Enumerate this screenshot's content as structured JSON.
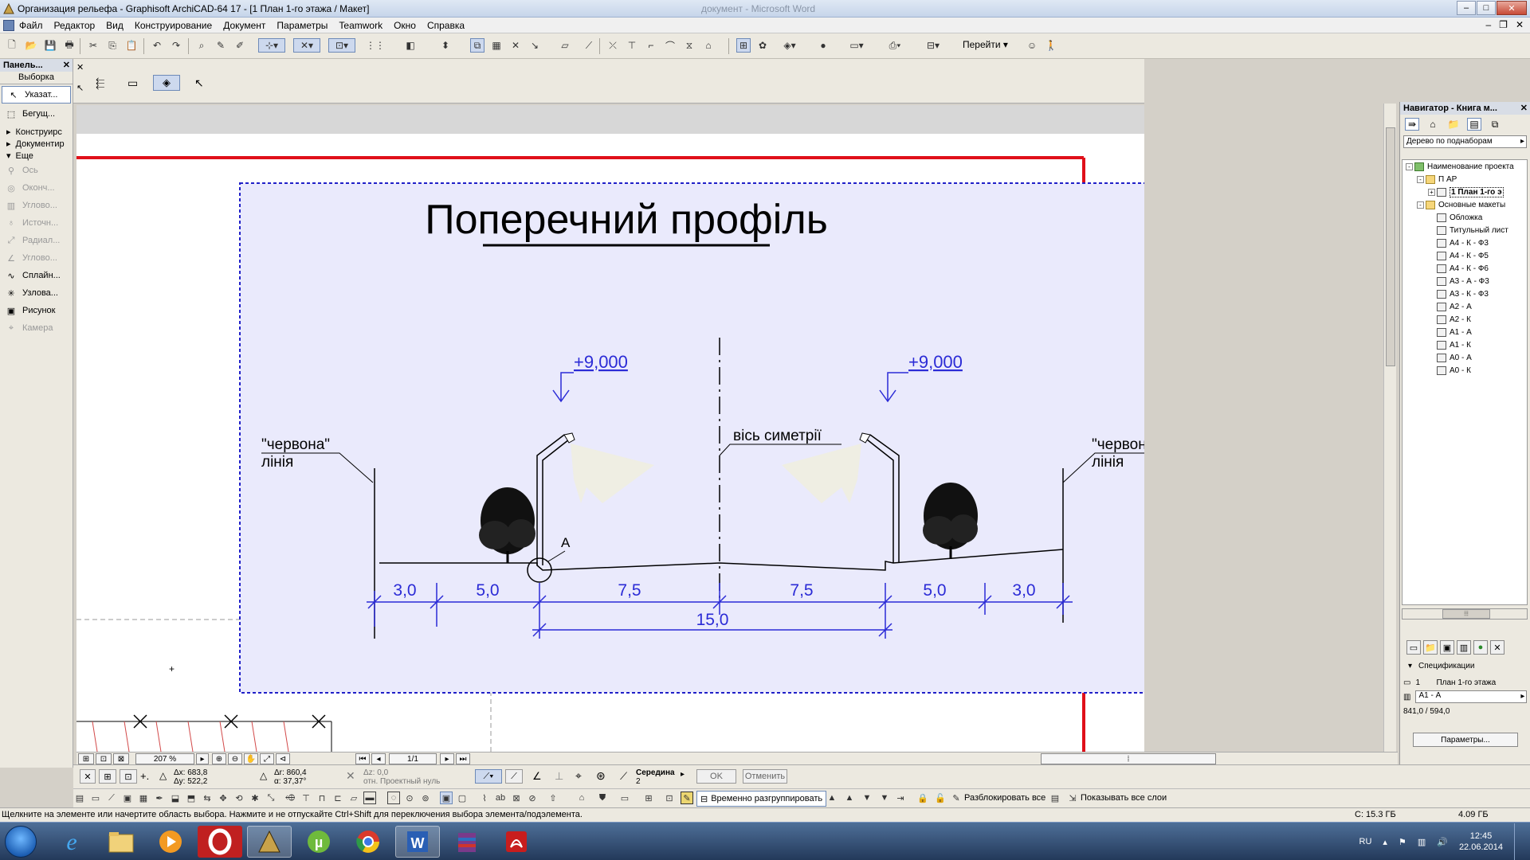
{
  "window": {
    "title": "Организация рельефа - Graphisoft ArchiCAD-64 17 - [1 План 1-го этажа / Макет]",
    "ghost_title": "документ - Microsoft Word"
  },
  "menu": {
    "items": [
      "Файл",
      "Редактор",
      "Вид",
      "Конструирование",
      "Документ",
      "Параметры",
      "Teamwork",
      "Окно",
      "Справка"
    ]
  },
  "toolbar": {
    "goto_label": "Перейти"
  },
  "toolbox": {
    "title": "Панель...",
    "tab": "Выборка",
    "selected_tools": [
      {
        "label": "Указат...",
        "icon": "arrow-pointer-icon"
      },
      {
        "label": "Бегущ...",
        "icon": "marquee-icon"
      }
    ],
    "sections": [
      {
        "label": "Конструирс",
        "expanded": false
      },
      {
        "label": "Документир",
        "expanded": false
      },
      {
        "label": "Еще",
        "expanded": true
      }
    ],
    "more_tools": [
      {
        "label": "Ось",
        "enabled": false,
        "icon": "axis-icon"
      },
      {
        "label": "Оконч...",
        "enabled": false,
        "icon": "finish-icon"
      },
      {
        "label": "Углово...",
        "enabled": false,
        "icon": "corner-window-icon"
      },
      {
        "label": "Источн...",
        "enabled": false,
        "icon": "lamp-icon"
      },
      {
        "label": "Радиал...",
        "enabled": false,
        "icon": "radial-dimension-icon"
      },
      {
        "label": "Углово...",
        "enabled": false,
        "icon": "angle-dimension-icon"
      },
      {
        "label": "Сплайн...",
        "enabled": true,
        "icon": "spline-icon"
      },
      {
        "label": "Узлова...",
        "enabled": true,
        "icon": "hotspot-icon"
      },
      {
        "label": "Рисунок",
        "enabled": true,
        "icon": "picture-icon"
      },
      {
        "label": "Камера",
        "enabled": false,
        "icon": "camera-icon"
      }
    ]
  },
  "drawing": {
    "title": "Поперечний профіль",
    "left_level": "+9,000",
    "right_level": "+9,000",
    "axis_label": "вісь симетрії",
    "red_line_left": [
      "\"червона\"",
      "лінія"
    ],
    "red_line_right": [
      "\"червона\"",
      "лінія"
    ],
    "point_label": "А",
    "dimensions": [
      "3,0",
      "5,0",
      "7,5",
      "7,5",
      "5,0",
      "3,0"
    ],
    "total_dimension": "15,0",
    "colors": {
      "annotation": "#2b2bd6",
      "background": "#eaeafc",
      "sheet_border": "#e0101a",
      "frame": "#2020c8"
    }
  },
  "view_controls": {
    "zoom": "207 %",
    "page": "1/1"
  },
  "navigator": {
    "title": "Навигатор - Книга м...",
    "dropdown": "Дерево по поднаборам",
    "tree": [
      {
        "label": "Наименование проекта",
        "level": 0,
        "expander": "-",
        "icon": "green"
      },
      {
        "label": "П АР",
        "level": 1,
        "expander": "-",
        "icon": "folder"
      },
      {
        "label": "1 План 1-го э",
        "level": 2,
        "expander": "+",
        "icon": "sheet",
        "selected": true
      },
      {
        "label": "Основные макеты",
        "level": 1,
        "expander": "-",
        "icon": "folder"
      },
      {
        "label": "Обложка",
        "level": 2,
        "expander": "",
        "icon": "sheet"
      },
      {
        "label": "Титульный лист",
        "level": 2,
        "expander": "",
        "icon": "sheet"
      },
      {
        "label": "А4 - К - Ф3",
        "level": 2,
        "expander": "",
        "icon": "sheet"
      },
      {
        "label": "А4 - К - Ф5",
        "level": 2,
        "expander": "",
        "icon": "sheet"
      },
      {
        "label": "А4 - К - Ф6",
        "level": 2,
        "expander": "",
        "icon": "sheet"
      },
      {
        "label": "А3 - А - Ф3",
        "level": 2,
        "expander": "",
        "icon": "sheet"
      },
      {
        "label": "А3 - К - Ф3",
        "level": 2,
        "expander": "",
        "icon": "sheet"
      },
      {
        "label": "А2 - А",
        "level": 2,
        "expander": "",
        "icon": "sheet"
      },
      {
        "label": "А2 - К",
        "level": 2,
        "expander": "",
        "icon": "sheet"
      },
      {
        "label": "А1 - А",
        "level": 2,
        "expander": "",
        "icon": "sheet"
      },
      {
        "label": "А1 - К",
        "level": 2,
        "expander": "",
        "icon": "sheet"
      },
      {
        "label": "А0 - А",
        "level": 2,
        "expander": "",
        "icon": "sheet"
      },
      {
        "label": "А0 - К",
        "level": 2,
        "expander": "",
        "icon": "sheet"
      }
    ],
    "specs_label": "Спецификации",
    "spec_number": "1",
    "spec_name": "План 1-го этажа",
    "spec_format": "А1 - А",
    "spec_size": "841,0 / 594,0",
    "params_button": "Параметры..."
  },
  "coordinates": {
    "dx": "Δx: 683,8",
    "dy": "Δy: 522,2",
    "dr": "Δr: 860,4",
    "angle": "α: 37,37°",
    "dz": "Δz: 0,0",
    "dz_ref": "отн. Проектный нуль",
    "snap_label": "Середина",
    "snap_value": "2",
    "ok": "OK",
    "cancel": "Отменить"
  },
  "bottom_toolbar": {
    "ungroup": "Временно разгруппировать",
    "unlock_all": "Разблокировать все",
    "show_layers": "Показывать все слои"
  },
  "status": {
    "message": "Щелкните на элементе или начертите область выбора. Нажмите и не отпускайте Ctrl+Shift для переключения выбора элемента/подэлемента.",
    "disk": "С: 15.3 ГБ",
    "memory": "4.09 ГБ"
  },
  "taskbar": {
    "lang": "RU",
    "time": "12:45",
    "date": "22.06.2014"
  }
}
